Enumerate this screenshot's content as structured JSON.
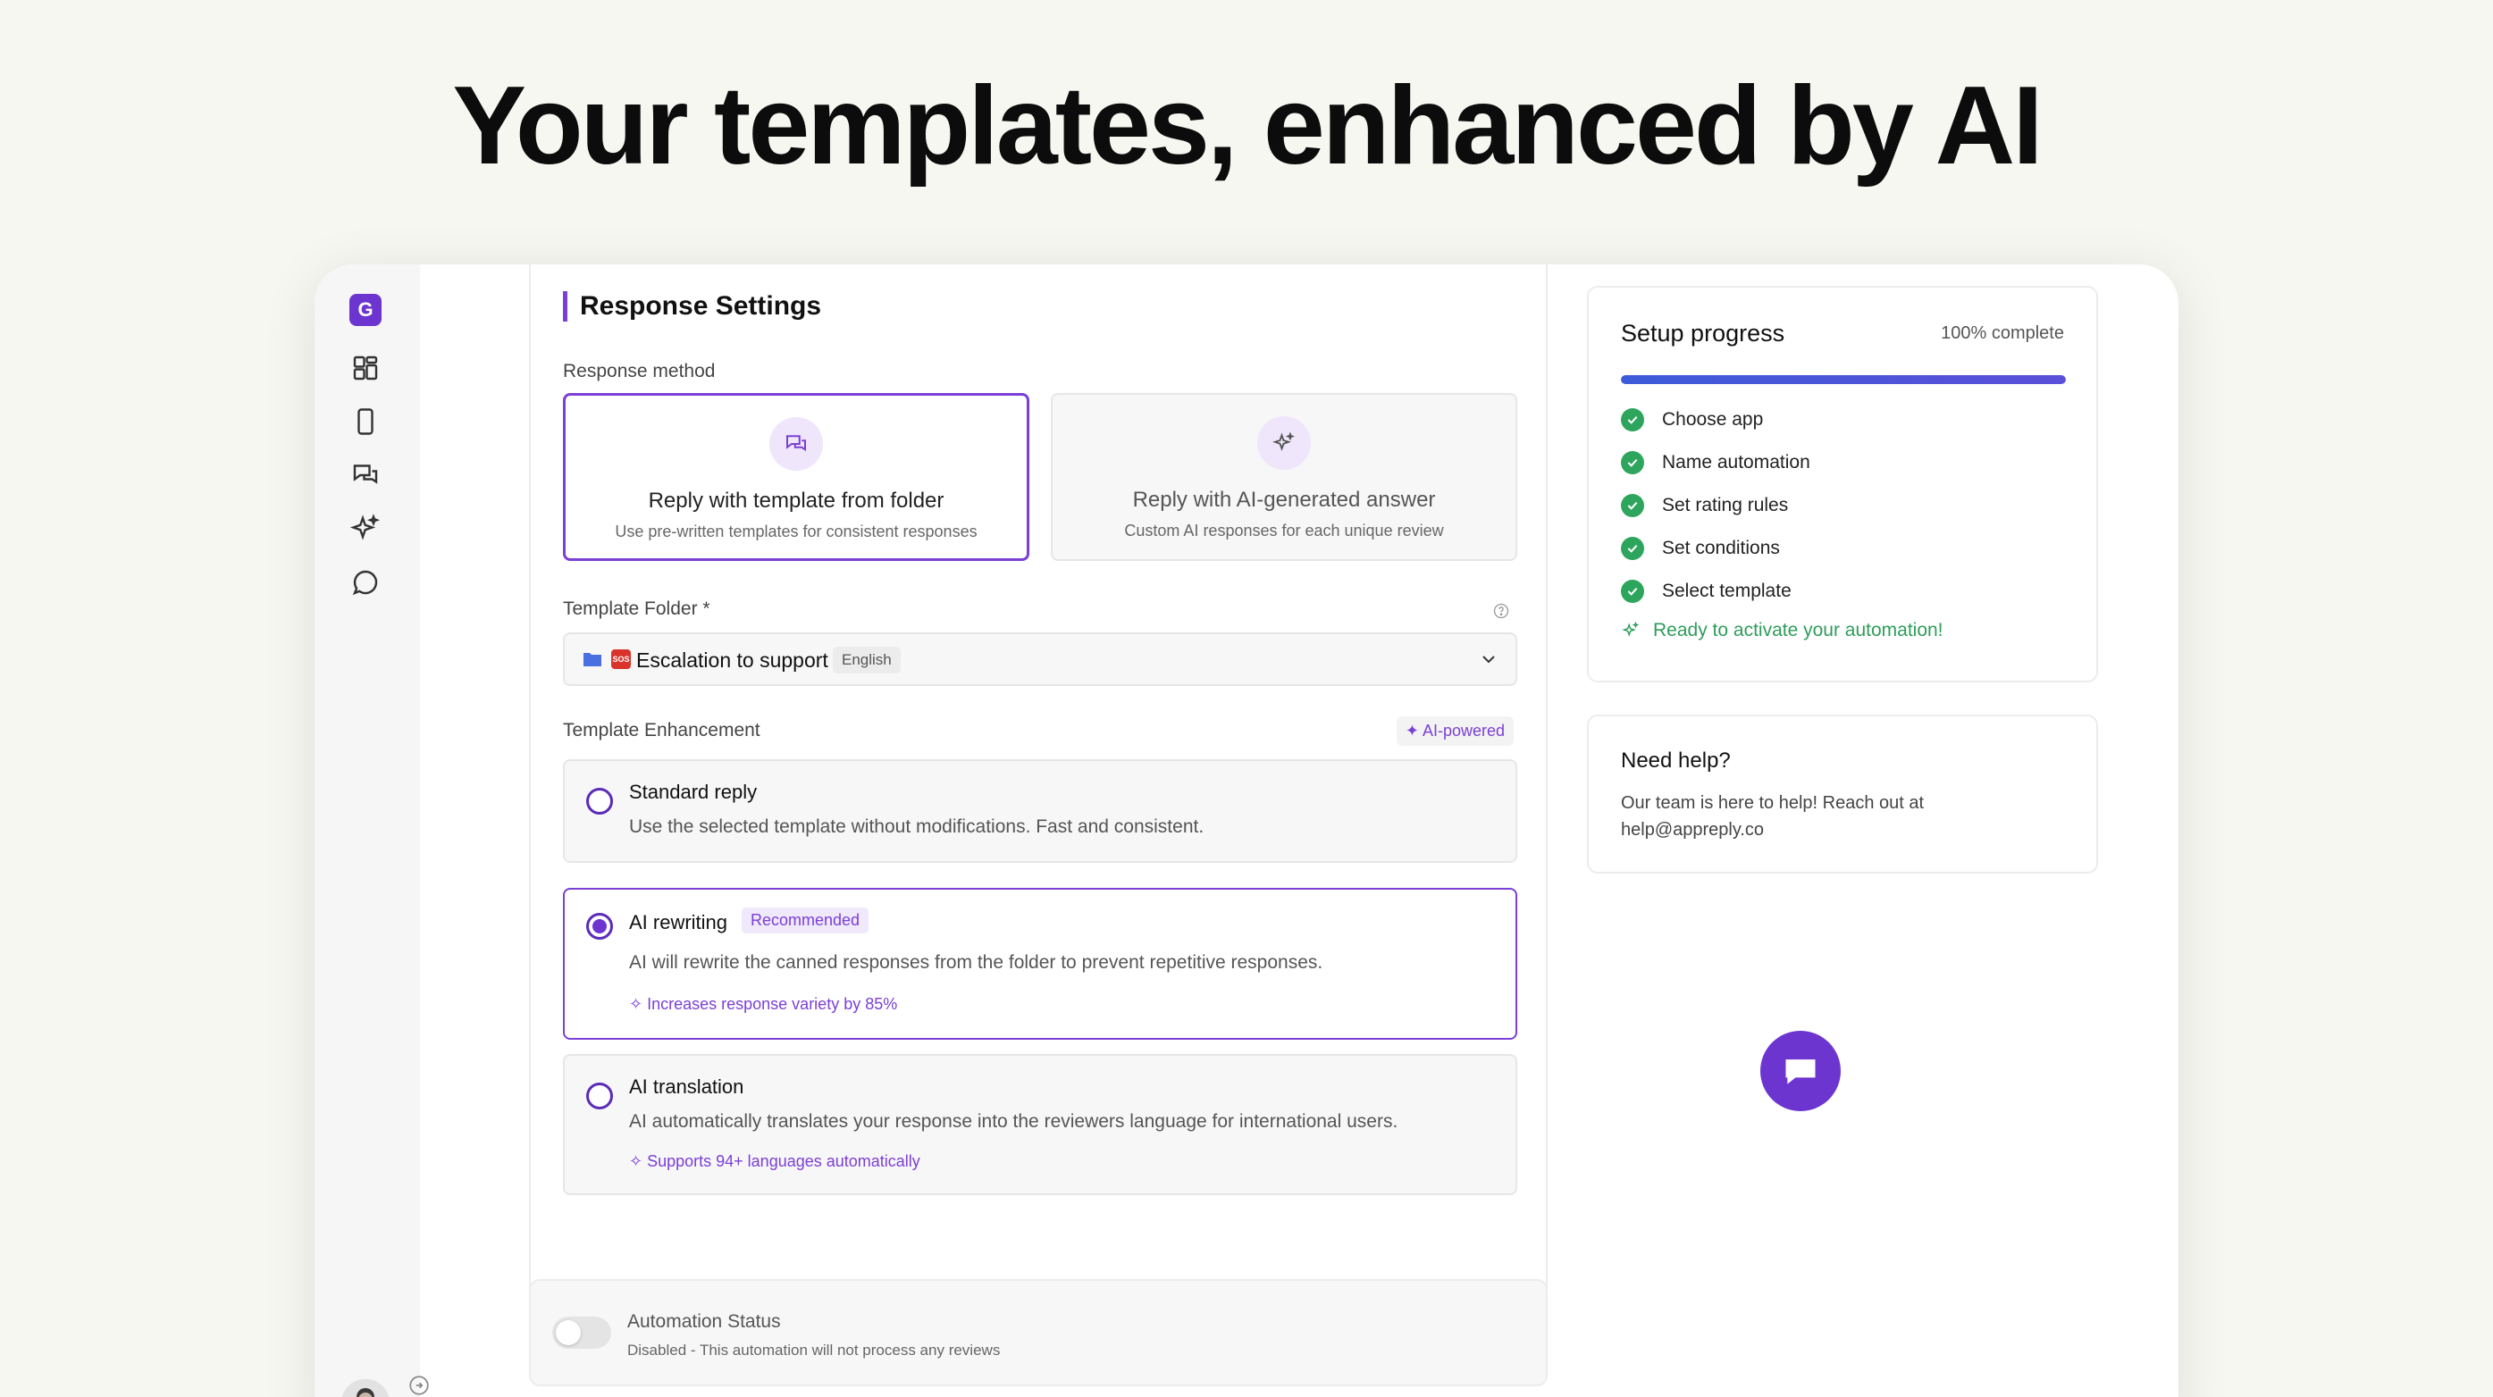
{
  "headline": "Your templates, enhanced by AI",
  "sidebar": {
    "logo_letter": "G",
    "icons": [
      "dashboard-icon",
      "phone-icon",
      "chat-icon",
      "sparkle-icon",
      "message-icon"
    ]
  },
  "response_settings": {
    "title": "Response Settings",
    "method_label": "Response method",
    "methods": [
      {
        "title": "Reply with template from folder",
        "subtitle": "Use pre-written templates for consistent responses",
        "selected": true
      },
      {
        "title": "Reply with AI-generated answer",
        "subtitle": "Custom AI responses for each unique review",
        "selected": false
      }
    ],
    "folder_label": "Template Folder *",
    "folder_value": "Escalation to support",
    "folder_emoji_text": "SOS",
    "folder_language": "English",
    "enhancement_label": "Template Enhancement",
    "ai_badge": "AI-powered",
    "options": [
      {
        "title": "Standard reply",
        "description": "Use the selected template without modifications. Fast and consistent.",
        "extra": "",
        "badge": "",
        "selected": false
      },
      {
        "title": "AI rewriting",
        "description": "AI will rewrite the canned responses from the folder to prevent repetitive responses.",
        "extra": "Increases response variety by 85%",
        "badge": "Recommended",
        "selected": true
      },
      {
        "title": "AI translation",
        "description": "AI automatically translates your response into the reviewers language for international users.",
        "extra": "Supports 94+ languages automatically",
        "badge": "",
        "selected": false
      }
    ]
  },
  "automation_status": {
    "title": "Automation Status",
    "subtitle": "Disabled - This automation will not process any reviews",
    "enabled": false
  },
  "setup_progress": {
    "title": "Setup progress",
    "percent_text": "100% complete",
    "progress": 1.0,
    "steps": [
      "Choose app",
      "Name automation",
      "Set rating rules",
      "Set conditions",
      "Select template"
    ],
    "ready_text": "Ready to activate your automation!"
  },
  "help": {
    "title": "Need help?",
    "text": "Our team is here to help! Reach out at help@appreply.co"
  },
  "colors": {
    "accent": "#6d35cf",
    "success": "#2ea55d",
    "progress": "#3d5bd9"
  }
}
